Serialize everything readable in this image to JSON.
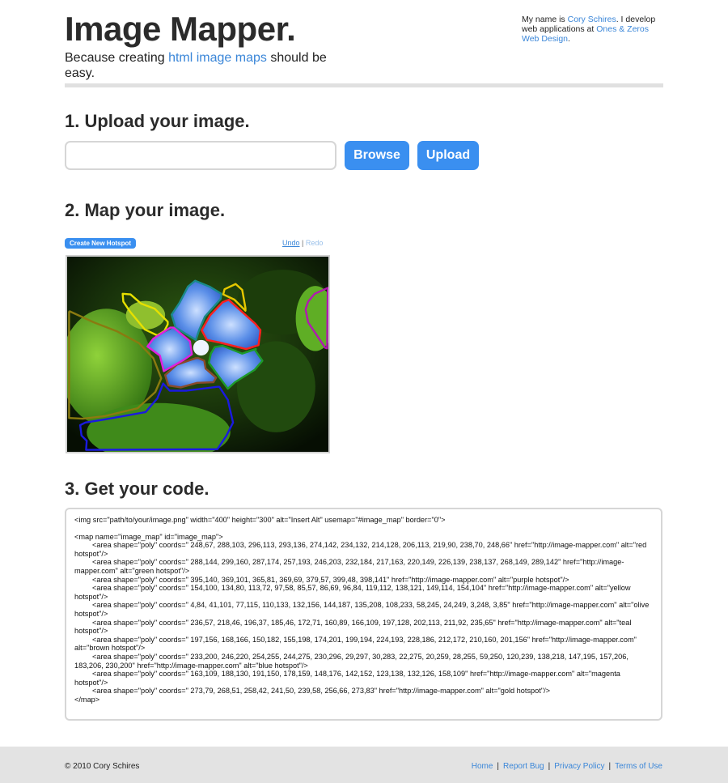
{
  "header": {
    "title": "Image Mapper.",
    "tagline_before": "Because creating ",
    "tagline_link": "html image maps",
    "tagline_after": " should be easy.",
    "about_before": "My name is ",
    "about_name": "Cory Schires",
    "about_middle": ". I develop web applications at ",
    "about_company": "Ones & Zeros Web Design",
    "about_after": "."
  },
  "upload": {
    "heading": "1. Upload your image.",
    "input_value": "",
    "browse_label": "Browse",
    "upload_label": "Upload"
  },
  "map": {
    "heading": "2. Map your image.",
    "create_hotspot_label": "Create New Hotspot",
    "undo_label": "Undo",
    "separator": "|",
    "redo_label": "Redo",
    "hotspots": [
      {
        "name": "red",
        "color": "#ff2020"
      },
      {
        "name": "green",
        "color": "#1e9a2a"
      },
      {
        "name": "purple",
        "color": "#b01ab0"
      },
      {
        "name": "yellow",
        "color": "#e6e000"
      },
      {
        "name": "olive",
        "color": "#8a7a10"
      },
      {
        "name": "teal",
        "color": "#1a8a8a"
      },
      {
        "name": "brown",
        "color": "#8a4a2a"
      },
      {
        "name": "blue",
        "color": "#1a1ae0"
      },
      {
        "name": "magenta",
        "color": "#e020e0"
      },
      {
        "name": "gold",
        "color": "#e6c800"
      }
    ]
  },
  "code": {
    "heading": "3. Get your code.",
    "lines": [
      "<img src=\"path/to/your/image.png\" width=\"400\" height=\"300\" alt=\"Insert Alt\" usemap=\"#image_map\" border=\"0\">",
      "",
      "<map name=\"image_map\" id=\"image_map\">",
      "<area shape=\"poly\" coords=\" 248,67, 288,103, 296,113, 293,136, 274,142, 234,132, 214,128, 206,113, 219,90, 238,70, 248,66\" href=\"http://image-mapper.com\" alt=\"red hotspot\"/>",
      "<area shape=\"poly\" coords=\" 288,144, 299,160, 287,174, 257,193, 246,203, 232,184, 217,163, 220,149, 226,139, 238,137, 268,149, 289,142\" href=\"http://image-mapper.com\" alt=\"green hotspot\"/>",
      "<area shape=\"poly\" coords=\" 395,140, 369,101, 365,81, 369,69, 379,57, 399,48, 398,141\" href=\"http://image-mapper.com\" alt=\"purple hotspot\"/>",
      "<area shape=\"poly\" coords=\" 154,100, 134,80, 113,72, 97,58, 85,57, 86,69, 96,84, 119,112, 138,121, 149,114, 154,104\" href=\"http://image-mapper.com\" alt=\"yellow hotspot\"/>",
      "<area shape=\"poly\" coords=\" 4,84, 41,101, 77,115, 110,133, 132,156, 144,187, 135,208, 108,233, 58,245, 24,249, 3,248, 3,85\" href=\"http://image-mapper.com\" alt=\"olive hotspot\"/>",
      "<area shape=\"poly\" coords=\" 236,57, 218,46, 196,37, 185,46, 172,71, 160,89, 166,109, 197,128, 202,113, 211,92, 235,65\" href=\"http://image-mapper.com\" alt=\"teal hotspot\"/>",
      "<area shape=\"poly\" coords=\" 197,156, 168,166, 150,182, 155,198, 174,201, 199,194, 224,193, 228,186, 212,172, 210,160, 201,156\" href=\"http://image-mapper.com\" alt=\"brown hotspot\"/>",
      "<area shape=\"poly\" coords=\" 233,200, 246,220, 254,255, 244,275, 230,296, 29,297, 30,283, 22,275, 20,259, 28,255, 59,250, 120,239, 138,218, 147,195, 157,206, 183,206, 230,200\" href=\"http://image-mapper.com\" alt=\"blue hotspot\"/>",
      "<area shape=\"poly\" coords=\" 163,109, 188,130, 191,150, 178,159, 148,176, 142,152, 123,138, 132,126, 158,109\" href=\"http://image-mapper.com\" alt=\"magenta hotspot\"/>",
      "<area shape=\"poly\" coords=\" 273,79, 268,51, 258,42, 241,50, 239,58, 256,66, 273,83\" href=\"http://image-mapper.com\" alt=\"gold hotspot\"/>",
      "</map>"
    ]
  },
  "footer": {
    "copyright": "© 2010 Cory Schires",
    "links": [
      "Home",
      "Report Bug",
      "Privacy Policy",
      "Terms of Use"
    ],
    "separator": "|"
  }
}
